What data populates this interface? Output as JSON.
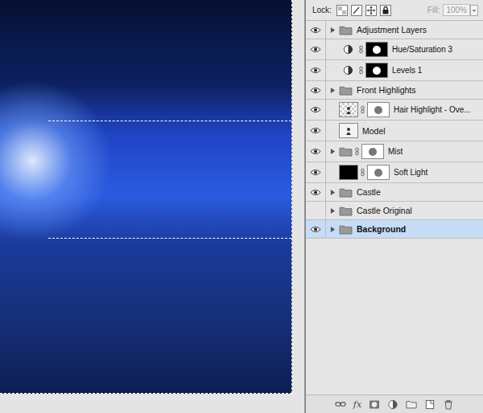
{
  "lock": {
    "label": "Lock:"
  },
  "fill": {
    "label": "Fill:",
    "value": "100%",
    "disabled": true
  },
  "layers": [
    {
      "name": "Adjustment Layers",
      "kind": "group",
      "thumb": "folder",
      "mask": false,
      "visible": true,
      "expanded": false,
      "selected": false
    },
    {
      "name": "Hue/Saturation 3",
      "kind": "adjustment",
      "thumb": "adjustment",
      "mask": true,
      "visible": true,
      "expanded": false,
      "selected": false
    },
    {
      "name": "Levels 1",
      "kind": "adjustment",
      "thumb": "adjustment",
      "mask": true,
      "visible": true,
      "expanded": false,
      "selected": false
    },
    {
      "name": "Front Highlights",
      "kind": "group",
      "thumb": "folder",
      "mask": false,
      "visible": true,
      "expanded": false,
      "selected": false
    },
    {
      "name": "Hair Highlight - Ove...",
      "kind": "layer",
      "thumb": "transparent",
      "mask": true,
      "visible": true,
      "expanded": false,
      "selected": false
    },
    {
      "name": "Model",
      "kind": "layer",
      "thumb": "figure",
      "mask": false,
      "visible": true,
      "expanded": false,
      "selected": false
    },
    {
      "name": "Mist",
      "kind": "group",
      "thumb": "folder",
      "mask": true,
      "visible": true,
      "expanded": false,
      "selected": false
    },
    {
      "name": "Soft Light",
      "kind": "layer",
      "thumb": "black",
      "mask": true,
      "visible": true,
      "expanded": false,
      "selected": false
    },
    {
      "name": "Castle",
      "kind": "group",
      "thumb": "folder",
      "mask": false,
      "visible": true,
      "expanded": false,
      "selected": false
    },
    {
      "name": "Castle Original",
      "kind": "group",
      "thumb": "folder",
      "mask": false,
      "visible": false,
      "expanded": false,
      "selected": false
    },
    {
      "name": "Background",
      "kind": "group",
      "thumb": "folder",
      "mask": false,
      "visible": true,
      "expanded": false,
      "selected": true
    }
  ],
  "footer": {
    "buttons": [
      {
        "kind": "link",
        "label": ""
      },
      {
        "kind": "fx",
        "label": "fx"
      },
      {
        "kind": "mask",
        "label": ""
      },
      {
        "kind": "adjustment",
        "label": ""
      },
      {
        "kind": "folder",
        "label": ""
      },
      {
        "kind": "new",
        "label": ""
      },
      {
        "kind": "trash",
        "label": ""
      }
    ]
  }
}
